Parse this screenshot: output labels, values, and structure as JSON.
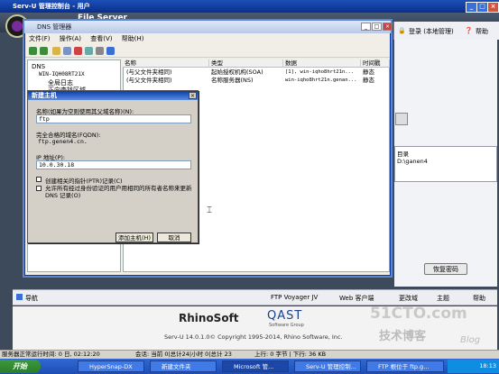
{
  "outer_window": {
    "title": "Serv-U 管理控制台 - 用户",
    "product": "File Server"
  },
  "top_right": {
    "login": "登录 (本地管理)",
    "help": "帮助"
  },
  "right_panel": {
    "path_title": "目录",
    "path_value": "D:\\ganen4",
    "reset_password": "恢复密码"
  },
  "dns_window": {
    "title": "DNS 管理器",
    "menu": [
      "文件(F)",
      "操作(A)",
      "查看(V)",
      "帮助(H)"
    ],
    "tree": [
      {
        "label": "DNS",
        "level": 0
      },
      {
        "label": "WIN-IQH08RT21X",
        "level": 1
      },
      {
        "label": "全局日志",
        "level": 2
      },
      {
        "label": "正向查找区域",
        "level": 2
      }
    ],
    "columns": [
      "名称",
      "类型",
      "数据",
      "时间戳"
    ],
    "rows": [
      {
        "name": "(与父文件夹相同)",
        "type": "起始授权机构(SOA)",
        "data": "[1], win-iqho8hrt21n...",
        "ts": "静态"
      },
      {
        "name": "(与父文件夹相同)",
        "type": "名称服务器(NS)",
        "data": "win-iqho8hrt21n.genan...",
        "ts": "静态"
      }
    ]
  },
  "dialog": {
    "title": "新建主机",
    "name_label": "名称(如果为空则使用其父域名称)(N):",
    "name_value": "ftp",
    "fqdn_label": "完全合格的域名(FQDN):",
    "fqdn_value": "ftp.genen4.cn.",
    "ip_label": "IP 地址(P):",
    "ip_value": "10.0.30.18",
    "chk1": "创建相关的指针(PTR)记录(C)",
    "chk2": "允许所有经过身份验证的用户用相同的所有者名称来更新 DNS 记录(O)",
    "ok": "添加主机(H)",
    "cancel": "取消"
  },
  "nav_strip": {
    "nav": "导航",
    "links": [
      "FTP Voyager JV",
      "Web 客户端",
      "更改域",
      "主题",
      "帮助"
    ]
  },
  "footer": {
    "rhino": "RhinoSoft",
    "qast": "QAST",
    "qast_sub": "Software Group",
    "copyright": "Serv-U 14.0.1.0© Copyright 1995-2014, Rhino Software, Inc."
  },
  "status": {
    "left": "服务器正常运行时间: 0 日, 02:12:20",
    "mid": "会话: 当前 0|总计24|小时 0|总计 23",
    "right": "上行: 0 字节 | 下行: 36 KB"
  },
  "watermark": {
    "site": "51CTO.com",
    "sub": "技术博客",
    "blog": "Blog"
  },
  "taskbar": {
    "start": "开始",
    "tasks": [
      "HyperSnap-DX",
      "新建文件夹",
      "Microsoft 管...",
      "Serv-U 管理控制...",
      "FTP 根位于 ftp.g..."
    ],
    "clock": "18:13"
  },
  "colors": {
    "title_blue": "#0a2f8c",
    "accent_purple": "#7a2a9a"
  }
}
